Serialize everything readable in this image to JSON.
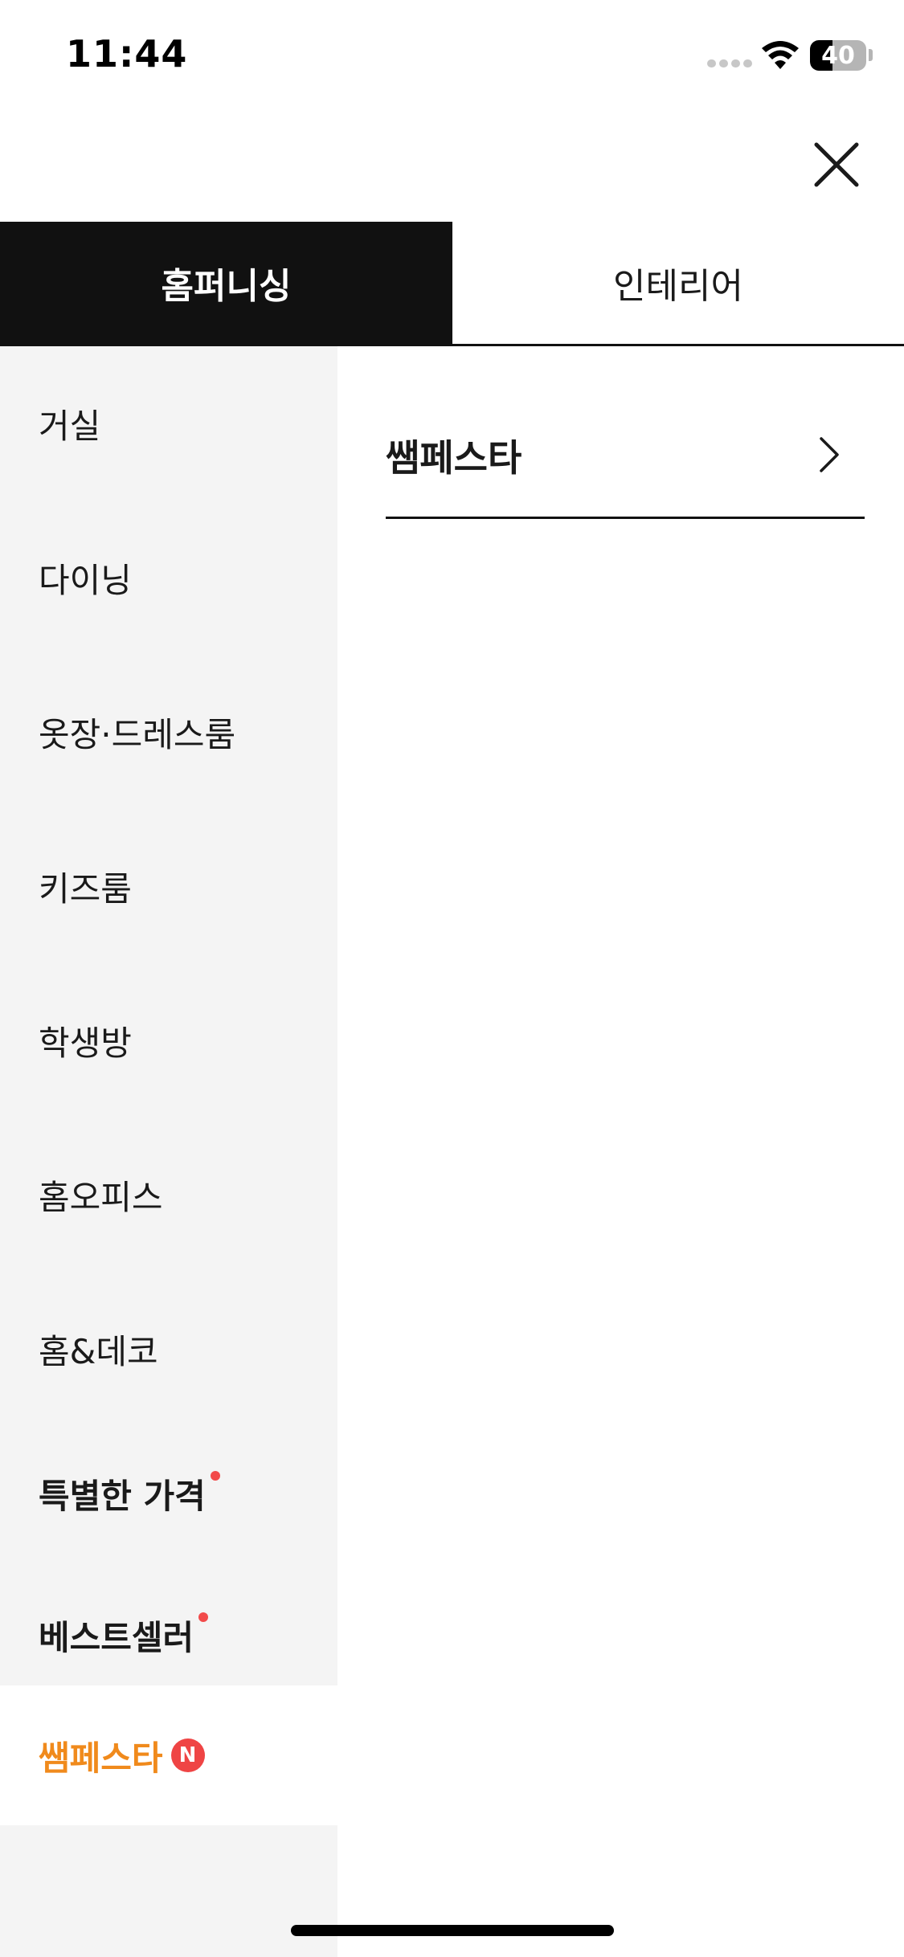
{
  "status_bar": {
    "time": "11:44",
    "battery_level": "40",
    "battery_fraction": 0.4,
    "icons": [
      "cellular-signal-icon",
      "wifi-icon",
      "battery-icon"
    ]
  },
  "header": {
    "close_icon": "close-icon"
  },
  "tabs": [
    {
      "label": "홈퍼니싱",
      "active": true
    },
    {
      "label": "인테리어",
      "active": false
    }
  ],
  "sidebar": {
    "items": [
      {
        "label": "거실"
      },
      {
        "label": "다이닝"
      },
      {
        "label": "옷장·드레스룸"
      },
      {
        "label": "키즈룸"
      },
      {
        "label": "학생방"
      },
      {
        "label": "홈오피스"
      },
      {
        "label": "홈&데코"
      },
      {
        "label": "특별한 가격",
        "bold": true,
        "dot": true
      },
      {
        "label": "베스트셀러",
        "bold": true,
        "dot": true
      },
      {
        "label": "쌤페스타",
        "selected": true,
        "badge": "N"
      }
    ]
  },
  "content": {
    "subcategory_label": "쌤페스타",
    "chevron_icon": "chevron-right-icon"
  },
  "colors": {
    "tab_active_bg": "#111111",
    "sidebar_bg": "#f4f4f4",
    "selected_text": "#f08a1c",
    "badge_red": "#ef4444"
  }
}
